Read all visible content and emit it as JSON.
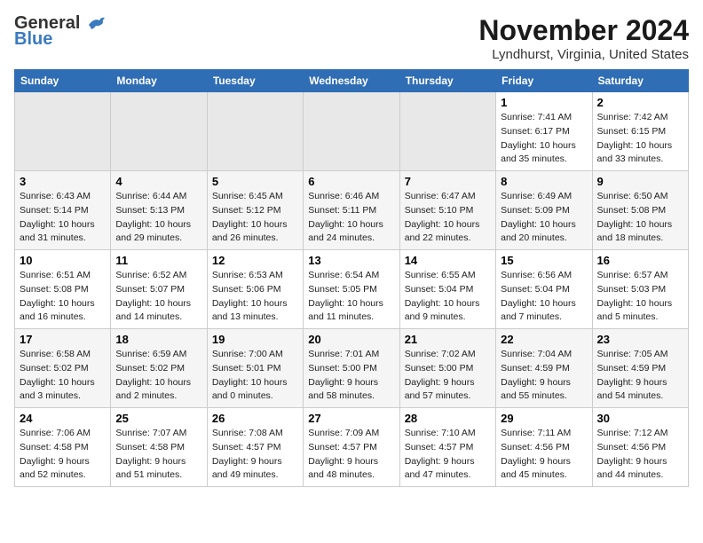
{
  "logo": {
    "general": "General",
    "blue": "Blue"
  },
  "title": "November 2024",
  "location": "Lyndhurst, Virginia, United States",
  "days_of_week": [
    "Sunday",
    "Monday",
    "Tuesday",
    "Wednesday",
    "Thursday",
    "Friday",
    "Saturday"
  ],
  "weeks": [
    [
      {
        "day": "",
        "info": ""
      },
      {
        "day": "",
        "info": ""
      },
      {
        "day": "",
        "info": ""
      },
      {
        "day": "",
        "info": ""
      },
      {
        "day": "",
        "info": ""
      },
      {
        "day": "1",
        "info": "Sunrise: 7:41 AM\nSunset: 6:17 PM\nDaylight: 10 hours and 35 minutes."
      },
      {
        "day": "2",
        "info": "Sunrise: 7:42 AM\nSunset: 6:15 PM\nDaylight: 10 hours and 33 minutes."
      }
    ],
    [
      {
        "day": "3",
        "info": "Sunrise: 6:43 AM\nSunset: 5:14 PM\nDaylight: 10 hours and 31 minutes."
      },
      {
        "day": "4",
        "info": "Sunrise: 6:44 AM\nSunset: 5:13 PM\nDaylight: 10 hours and 29 minutes."
      },
      {
        "day": "5",
        "info": "Sunrise: 6:45 AM\nSunset: 5:12 PM\nDaylight: 10 hours and 26 minutes."
      },
      {
        "day": "6",
        "info": "Sunrise: 6:46 AM\nSunset: 5:11 PM\nDaylight: 10 hours and 24 minutes."
      },
      {
        "day": "7",
        "info": "Sunrise: 6:47 AM\nSunset: 5:10 PM\nDaylight: 10 hours and 22 minutes."
      },
      {
        "day": "8",
        "info": "Sunrise: 6:49 AM\nSunset: 5:09 PM\nDaylight: 10 hours and 20 minutes."
      },
      {
        "day": "9",
        "info": "Sunrise: 6:50 AM\nSunset: 5:08 PM\nDaylight: 10 hours and 18 minutes."
      }
    ],
    [
      {
        "day": "10",
        "info": "Sunrise: 6:51 AM\nSunset: 5:08 PM\nDaylight: 10 hours and 16 minutes."
      },
      {
        "day": "11",
        "info": "Sunrise: 6:52 AM\nSunset: 5:07 PM\nDaylight: 10 hours and 14 minutes."
      },
      {
        "day": "12",
        "info": "Sunrise: 6:53 AM\nSunset: 5:06 PM\nDaylight: 10 hours and 13 minutes."
      },
      {
        "day": "13",
        "info": "Sunrise: 6:54 AM\nSunset: 5:05 PM\nDaylight: 10 hours and 11 minutes."
      },
      {
        "day": "14",
        "info": "Sunrise: 6:55 AM\nSunset: 5:04 PM\nDaylight: 10 hours and 9 minutes."
      },
      {
        "day": "15",
        "info": "Sunrise: 6:56 AM\nSunset: 5:04 PM\nDaylight: 10 hours and 7 minutes."
      },
      {
        "day": "16",
        "info": "Sunrise: 6:57 AM\nSunset: 5:03 PM\nDaylight: 10 hours and 5 minutes."
      }
    ],
    [
      {
        "day": "17",
        "info": "Sunrise: 6:58 AM\nSunset: 5:02 PM\nDaylight: 10 hours and 3 minutes."
      },
      {
        "day": "18",
        "info": "Sunrise: 6:59 AM\nSunset: 5:02 PM\nDaylight: 10 hours and 2 minutes."
      },
      {
        "day": "19",
        "info": "Sunrise: 7:00 AM\nSunset: 5:01 PM\nDaylight: 10 hours and 0 minutes."
      },
      {
        "day": "20",
        "info": "Sunrise: 7:01 AM\nSunset: 5:00 PM\nDaylight: 9 hours and 58 minutes."
      },
      {
        "day": "21",
        "info": "Sunrise: 7:02 AM\nSunset: 5:00 PM\nDaylight: 9 hours and 57 minutes."
      },
      {
        "day": "22",
        "info": "Sunrise: 7:04 AM\nSunset: 4:59 PM\nDaylight: 9 hours and 55 minutes."
      },
      {
        "day": "23",
        "info": "Sunrise: 7:05 AM\nSunset: 4:59 PM\nDaylight: 9 hours and 54 minutes."
      }
    ],
    [
      {
        "day": "24",
        "info": "Sunrise: 7:06 AM\nSunset: 4:58 PM\nDaylight: 9 hours and 52 minutes."
      },
      {
        "day": "25",
        "info": "Sunrise: 7:07 AM\nSunset: 4:58 PM\nDaylight: 9 hours and 51 minutes."
      },
      {
        "day": "26",
        "info": "Sunrise: 7:08 AM\nSunset: 4:57 PM\nDaylight: 9 hours and 49 minutes."
      },
      {
        "day": "27",
        "info": "Sunrise: 7:09 AM\nSunset: 4:57 PM\nDaylight: 9 hours and 48 minutes."
      },
      {
        "day": "28",
        "info": "Sunrise: 7:10 AM\nSunset: 4:57 PM\nDaylight: 9 hours and 47 minutes."
      },
      {
        "day": "29",
        "info": "Sunrise: 7:11 AM\nSunset: 4:56 PM\nDaylight: 9 hours and 45 minutes."
      },
      {
        "day": "30",
        "info": "Sunrise: 7:12 AM\nSunset: 4:56 PM\nDaylight: 9 hours and 44 minutes."
      }
    ]
  ]
}
